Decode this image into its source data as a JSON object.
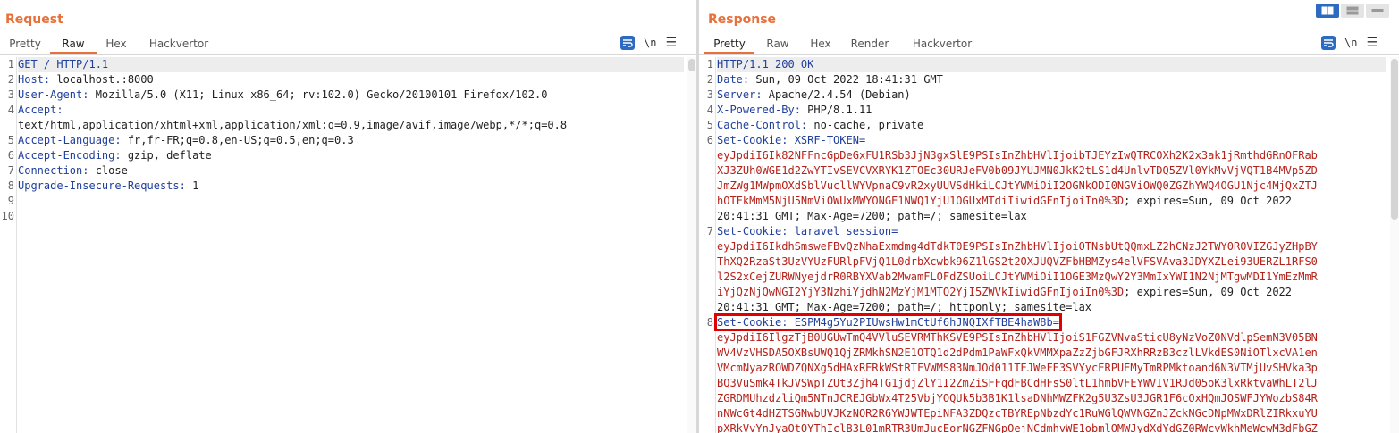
{
  "request": {
    "title": "Request",
    "tabs": [
      "Pretty",
      "Raw",
      "Hex",
      "Hackvertor"
    ],
    "active_tab": "Raw",
    "tool_newline": "\\n",
    "lines": [
      {
        "n": "1",
        "k": "GET / HTTP/1.1",
        "v": ""
      },
      {
        "n": "2",
        "k": "Host:",
        "v": " localhost.:8000"
      },
      {
        "n": "3",
        "k": "User-Agent:",
        "v": " Mozilla/5.0 (X11; Linux x86_64; rv:102.0) Gecko/20100101 Firefox/102.0"
      },
      {
        "n": "4",
        "k": "Accept:",
        "v": ""
      },
      {
        "n": "",
        "k": "",
        "v": "text/html,application/xhtml+xml,application/xml;q=0.9,image/avif,image/webp,*/*;q=0.8"
      },
      {
        "n": "5",
        "k": "Accept-Language:",
        "v": " fr,fr-FR;q=0.8,en-US;q=0.5,en;q=0.3"
      },
      {
        "n": "6",
        "k": "Accept-Encoding:",
        "v": " gzip, deflate"
      },
      {
        "n": "7",
        "k": "Connection:",
        "v": " close"
      },
      {
        "n": "8",
        "k": "Upgrade-Insecure-Requests:",
        "v": " 1"
      },
      {
        "n": "9",
        "k": "",
        "v": ""
      },
      {
        "n": "10",
        "k": "",
        "v": ""
      }
    ]
  },
  "response": {
    "title": "Response",
    "tabs": [
      "Pretty",
      "Raw",
      "Hex",
      "Render",
      "Hackvertor"
    ],
    "active_tab": "Pretty",
    "tool_newline": "\\n",
    "lines": [
      {
        "n": "1",
        "k": "HTTP/1.1 200 OK",
        "v": "",
        "r": ""
      },
      {
        "n": "2",
        "k": "Date:",
        "v": " Sun, 09 Oct 2022 18:41:31 GMT",
        "r": ""
      },
      {
        "n": "3",
        "k": "Server:",
        "v": " Apache/2.4.54 (Debian)",
        "r": ""
      },
      {
        "n": "4",
        "k": "X-Powered-By:",
        "v": " PHP/8.1.11",
        "r": ""
      },
      {
        "n": "5",
        "k": "Cache-Control:",
        "v": " no-cache, private",
        "r": ""
      },
      {
        "n": "6",
        "k": "Set-Cookie:",
        "v": " XSRF-TOKEN=",
        "r": ""
      },
      {
        "n": "",
        "k": "",
        "v": "",
        "r": "eyJpdiI6Ik82NFFncGpDeGxFU1RSb3JjN3gxSlE9PSIsInZhbHVlIjoibTJEYzIwQTRCOXh2K2x3ak1jRmthdGRnOFRab"
      },
      {
        "n": "",
        "k": "",
        "v": "",
        "r": "XJ3ZUh0WGE1d2ZwYTIvSEVCVXRYK1ZTOEc30URJeFV0b09JYUJMN0JkK2tLS1d4UnlvTDQ5ZVl0YkMvVjVQT1B4MVp5ZD"
      },
      {
        "n": "",
        "k": "",
        "v": "",
        "r": "JmZWg1MWpmOXdSblVucllWYVpnaC9vR2xyUUVSdHkiLCJtYWMiOiI2OGNkODI0NGViOWQ0ZGZhYWQ4OGU1Njc4MjQxZTJ"
      },
      {
        "n": "",
        "k": "",
        "v": "",
        "r": "hOTFkMmM5NjU5NmViOWUxMWYONGE1NWQ1YjU1OGUxMTdiIiwidGFnIjoiIn0%3D",
        "tail": "; expires=Sun, 09 Oct 2022"
      },
      {
        "n": "",
        "k": "",
        "v": "20:41:31 GMT; Max-Age=7200; path=/; samesite=lax",
        "r": ""
      },
      {
        "n": "7",
        "k": "Set-Cookie:",
        "v": " laravel_session=",
        "r": ""
      },
      {
        "n": "",
        "k": "",
        "v": "",
        "r": "eyJpdiI6IkdhSmsweFBvQzNhaExmdmg4dTdkT0E9PSIsInZhbHVlIjoiOTNsbUtQQmxLZ2hCNzJ2TWY0R0VIZGJyZHpBY"
      },
      {
        "n": "",
        "k": "",
        "v": "",
        "r": "ThXQ2RzaSt3UzVYUzFURlpFVjQ1L0drbXcwbk96Z1lGS2t2OXJUQVZFbHBMZys4elVFSVAva3JDYXZLei93UERZL1RFS0"
      },
      {
        "n": "",
        "k": "",
        "v": "",
        "r": "l2S2xCejZURWNyejdrR0RBYXVab2MwamFLOFdZSUoiLCJtYWMiOiI1OGE3MzQwY2Y3MmIxYWI1N2NjMTgwMDI1YmEzMmR"
      },
      {
        "n": "",
        "k": "",
        "v": "",
        "r": "iYjQzNjQwNGI2YjY3NzhiYjdhN2MzYjM1MTQ2YjI5ZWVkIiwidGFnIjoiIn0%3D",
        "tail": "; expires=Sun, 09 Oct 2022"
      },
      {
        "n": "",
        "k": "",
        "v": "20:41:31 GMT; Max-Age=7200; path=/; httponly; samesite=lax",
        "r": ""
      },
      {
        "n": "8",
        "k": "Set-Cookie:",
        "v": " ESPM4g5Yu2PIUwsHw1mCtUf6hJNQIXfTBE4haW8b=",
        "r": "",
        "marked": true
      },
      {
        "n": "",
        "k": "",
        "v": "",
        "r": "eyJpdiI6IlgzTjB0UGUwTmQ4VVluSEVRMThKSVE9PSIsInZhbHVlIjoiS1FGZVNvaSticU8yNzVoZ0NVdlpSemN3V05BN"
      },
      {
        "n": "",
        "k": "",
        "v": "",
        "r": "WV4VzVHSDA5OXBsUWQ1QjZRMkhSN2E1OTQ1d2dPdm1PaWFxQkVMMXpaZzZjbGFJRXhRRzB3czlLVkdES0NiOTlxcVA1en"
      },
      {
        "n": "",
        "k": "",
        "v": "",
        "r": "VMcmNyazROWDZQNXg5dHAxRERkWStRTFVWMS83NmJOd011TEJWeFE3SVYycERPUEMyTmRPMktoand6N3VTMjUvSHVka3p"
      },
      {
        "n": "",
        "k": "",
        "v": "",
        "r": "BQ3VuSmk4TkJVSWpTZUt3Zjh4TG1jdjZlY1I2ZmZiSFFqdFBCdHFsS0ltL1hmbVFEYWVIV1RJd05oK3lxRktvaWhLT2lJ"
      },
      {
        "n": "",
        "k": "",
        "v": "",
        "r": "ZGRDMUhzdzliQm5NTnJCREJGbWx4T25VbjYOQUk5b3B1K1lsaDNhMWZFK2g5U3ZsU3JGR1F6cOxHQmJOSWFJYWozbS84R"
      },
      {
        "n": "",
        "k": "",
        "v": "",
        "r": "nNWcGt4dHZTSGNwbUVJKzNOR2R6YWJWTEpiNFA3ZDQzcTBYREpNbzdYc1RuWGlQWVNGZnJZckNGcDNpMWxDRlZIRkxuYU"
      },
      {
        "n": "",
        "k": "",
        "v": "",
        "r": "pXRkVvYnJyaOtOYThIclB3L01mRTR3UmJucEorNGZFNGpOejNCdmhvWE1obmlOMWJydXdYdGZ0RWcvWkhMeWcwM3dFbGZ"
      }
    ]
  }
}
